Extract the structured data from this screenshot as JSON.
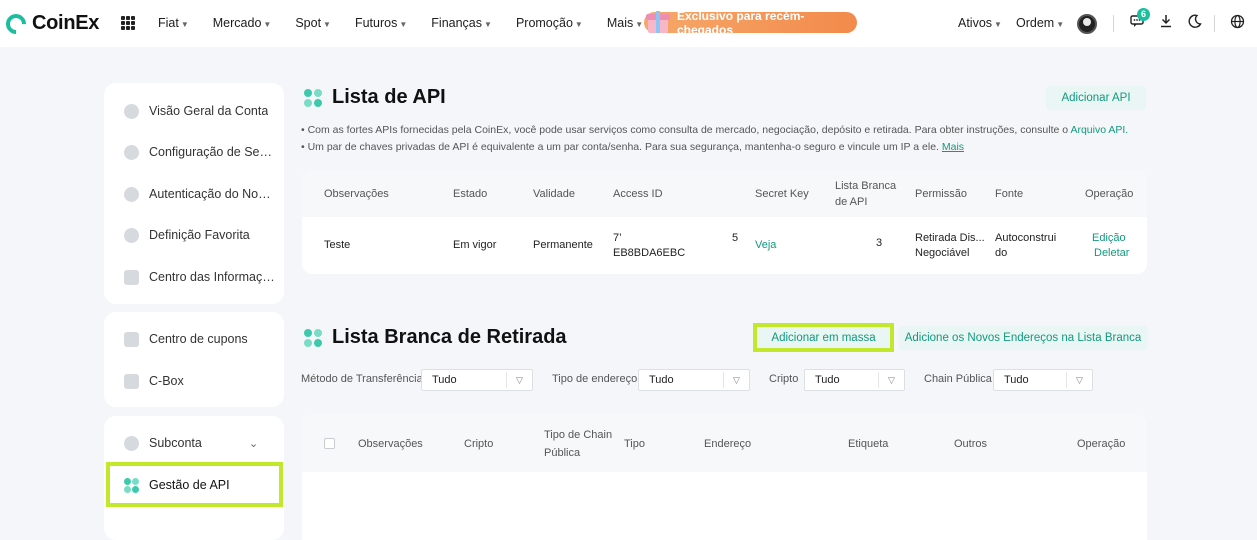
{
  "header": {
    "brand": "CoinEx",
    "nav": [
      "Fiat",
      "Mercado",
      "Spot",
      "Futuros",
      "Finanças",
      "Promoção",
      "Mais"
    ],
    "promo": "Exclusivo para recém-chegados",
    "assets": "Ativos",
    "orders": "Ordem",
    "notifications_count": "6",
    "icons": [
      "grid-icon",
      "user-avatar",
      "message-icon",
      "download-icon",
      "moon-icon",
      "globe-icon"
    ]
  },
  "sidebar": {
    "group1": [
      "Visão Geral da Conta",
      "Configuração de Segu...",
      "Autenticação do Nome...",
      "Definição Favorita",
      "Centro das Informações"
    ],
    "group2": [
      "Centro de cupons",
      "C-Box"
    ],
    "group3": {
      "subaccount": "Subconta",
      "api": "Gestão de API"
    }
  },
  "api_list": {
    "title": "Lista de API",
    "add_button": "Adicionar API",
    "bullet1_text": "Com as fortes APIs fornecidas pela CoinEx, você pode usar serviços como consulta de mercado, negociação, depósito e retirada. Para obter instruções, consulte o",
    "bullet1_link": "Arquivo API.",
    "bullet2_text": "Um par de chaves privadas de API é equivalente a um par conta/senha. Para sua segurança, mantenha-o seguro e vincule um IP a ele.",
    "bullet2_link": "Mais",
    "columns": {
      "notes": "Observações",
      "status": "Estado",
      "validity": "Validade",
      "access_id": "Access ID",
      "secret_key": "Secret Key",
      "whitelist_l1": "Lista Branca",
      "whitelist_l2": "de API",
      "permission": "Permissão",
      "source": "Fonte",
      "operation": "Operação"
    },
    "row": {
      "notes": "Teste",
      "status": "Em vigor",
      "validity": "Permanente",
      "access_id_l1": "7’",
      "access_id_tail": "5",
      "access_id_l2": "EB8BDA6EBC",
      "secret_key": "Veja",
      "whitelist": "3",
      "permission_l1": "Retirada Dis...",
      "permission_l2": "Negociável",
      "source_l1": "Autoconstrui",
      "source_l2": "do",
      "edit": "Edição",
      "delete": "Deletar"
    }
  },
  "withdrawal_whitelist": {
    "title": "Lista Branca de Retirada",
    "bulk_add": "Adicionar em massa",
    "add_new": "Adicione os Novos Endereços na Lista Branca",
    "filters": [
      {
        "label": "Método de Transferência",
        "value": "Tudo"
      },
      {
        "label": "Tipo de endereço",
        "value": "Tudo"
      },
      {
        "label": "Cripto",
        "value": "Tudo"
      },
      {
        "label": "Chain Pública",
        "value": "Tudo"
      }
    ],
    "columns": {
      "notes": "Observações",
      "crypto": "Cripto",
      "chain_l1": "Tipo de Chain",
      "chain_l2": "Pública",
      "type": "Tipo",
      "address": "Endereço",
      "tag": "Etiqueta",
      "others": "Outros",
      "operation": "Operação"
    }
  }
}
